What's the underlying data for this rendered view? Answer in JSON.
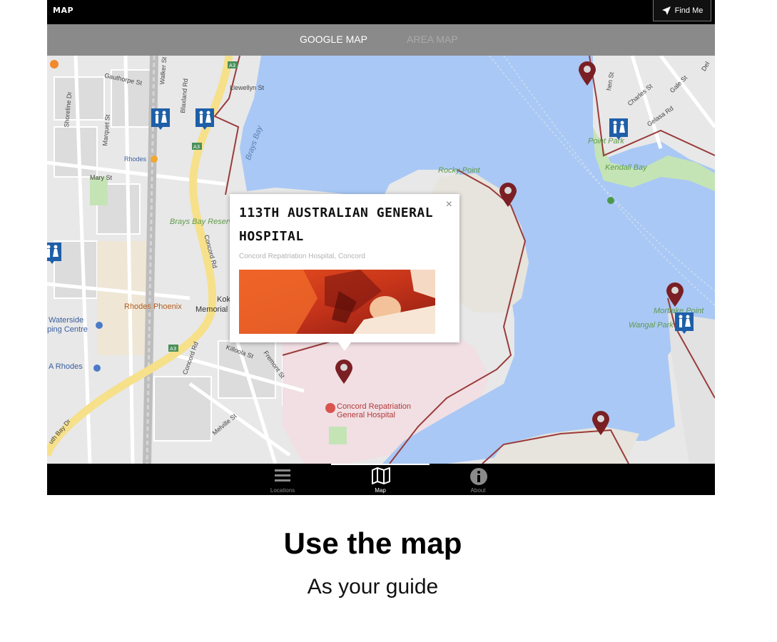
{
  "header": {
    "title": "MAP",
    "find_me_label": "Find Me"
  },
  "tabs": [
    {
      "label": "GOOGLE MAP",
      "active": true
    },
    {
      "label": "AREA MAP",
      "active": false
    }
  ],
  "map_labels": {
    "water_brays_bay": "Brays Bay",
    "rocky_point": "Rocky Point",
    "kendall_bay": "Kendall Bay",
    "point_park": "Point Park",
    "mortlake_point": "Mortlake Point",
    "wangal_park": "Wangal Park",
    "brays_bay_reserve": "Brays Bay Reserve",
    "rhodes_phoenix": "Rhodes Phoenix",
    "waterside": "Waterside",
    "shopping_centre": "ping Centre",
    "a_rhodes": "A Rhodes",
    "rhodes_station": "Rhodes",
    "memorial": "Memorial",
    "kokoda": "Kok",
    "hospital": "Concord Repatriation General Hospital",
    "streets": {
      "gauthorpe": "Gauthorpe St",
      "llewellyn": "Llewellyn St",
      "mary": "Mary St",
      "walker": "Walker St",
      "blaxland": "Blaxland Rd",
      "shoreline": "Shoreline Dr",
      "marquet": "Marquet St",
      "concord_rd": "Concord Rd",
      "killoola": "Killoola St",
      "fremont": "Fremont St",
      "melville": "Melville St",
      "concord_rd_2": "Concord Rd",
      "bay_dr": "uth Bay Dr",
      "charles": "Charles St",
      "gale": "Gale St",
      "hen": "hen St",
      "gelasa": "Gelasa Rd",
      "del": "Del"
    },
    "road_shields": [
      "A3",
      "A3",
      "A3"
    ]
  },
  "popup": {
    "title_line1": "113TH AUSTRALIAN GENERAL",
    "title_line2": "HOSPITAL",
    "subtitle": "Concord Repatriation Hospital, Concord",
    "close_glyph": "×"
  },
  "bottom_nav": [
    {
      "label": "Locations",
      "icon": "menu-icon",
      "active": false
    },
    {
      "label": "Map",
      "icon": "map-icon",
      "active": true
    },
    {
      "label": "About",
      "icon": "info-icon",
      "active": false
    }
  ],
  "caption": {
    "headline": "Use the map",
    "subline": "As your guide"
  },
  "colors": {
    "water": "#a9c8f5",
    "land": "#e8e8e8",
    "park": "#c5e4b5",
    "highway": "#f6e08a",
    "boundary": "#9a3b3b",
    "pin": "#7a1f24",
    "toilet_badge": "#1f5fa8"
  }
}
